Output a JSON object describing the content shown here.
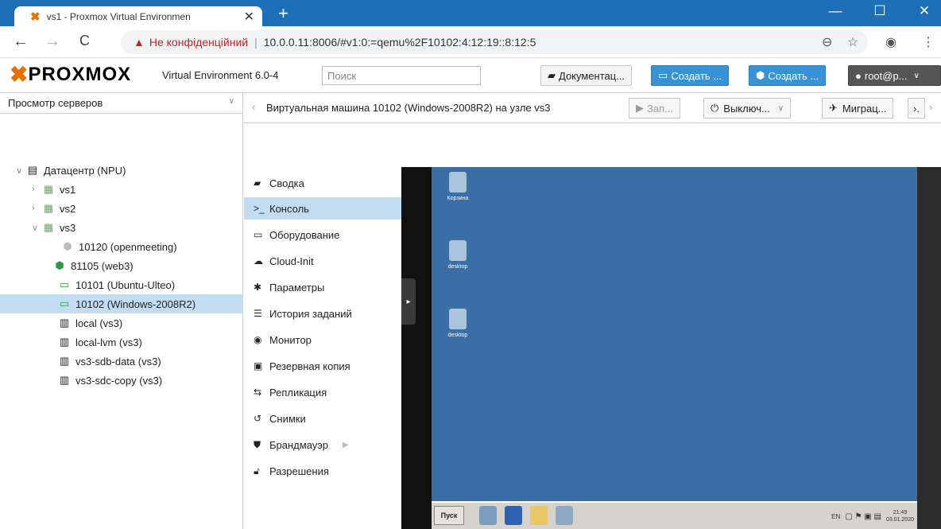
{
  "browser": {
    "tab_title": "vs1 - Proxmox Virtual Environmen",
    "tab_close": "✕",
    "new_tab": "+",
    "win_min": "—",
    "win_max": "☐",
    "win_close": "✕",
    "nav_back": "←",
    "nav_forward": "→",
    "nav_reload": "C",
    "security_warning": "Не конфіденційний",
    "url": "10.0.0.11:8006/#v1:0:=qemu%2F10102:4:12:19::8:12:5"
  },
  "header": {
    "logo_text": "PROXMOX",
    "version": "Virtual Environment 6.0-4",
    "search_placeholder": "Поиск",
    "docs_label": "Документац...",
    "create_vm_label": "Создать ...",
    "create_ct_label": "Создать ...",
    "user_label": "root@p...",
    "accent_color": "#e57000"
  },
  "tree": {
    "view_selector": "Просмотр серверов",
    "nodes": [
      {
        "label": "Датацентр (NPU)",
        "icon": "datacenter-icon"
      },
      {
        "label": "vs1",
        "icon": "node-icon"
      },
      {
        "label": "vs2",
        "icon": "node-icon"
      },
      {
        "label": "vs3",
        "icon": "node-icon"
      },
      {
        "label": "10120 (openmeeting)",
        "icon": "container-icon"
      },
      {
        "label": "81105 (web3)",
        "icon": "container-running-icon"
      },
      {
        "label": "10101 (Ubuntu-Ulteo)",
        "icon": "vm-running-icon"
      },
      {
        "label": "10102 (Windows-2008R2)",
        "icon": "vm-running-icon"
      },
      {
        "label": "local (vs3)",
        "icon": "storage-icon"
      },
      {
        "label": "local-lvm (vs3)",
        "icon": "storage-icon"
      },
      {
        "label": "vs3-sdb-data (vs3)",
        "icon": "storage-icon"
      },
      {
        "label": "vs3-sdc-copy (vs3)",
        "icon": "storage-icon"
      }
    ]
  },
  "content": {
    "title": "Виртуальная машина 10102 (Windows-2008R2) на узле vs3",
    "start_label": "Зап...",
    "shutdown_label": "Выключ...",
    "migrate_label": "Миграц...",
    "more_label": "›."
  },
  "menu": [
    {
      "label": "Сводка",
      "icon": "book-icon"
    },
    {
      "label": "Консоль",
      "icon": "terminal-icon"
    },
    {
      "label": "Оборудование",
      "icon": "monitor-icon"
    },
    {
      "label": "Cloud-Init",
      "icon": "cloud-icon"
    },
    {
      "label": "Параметры",
      "icon": "gear-icon"
    },
    {
      "label": "История заданий",
      "icon": "list-icon"
    },
    {
      "label": "Монитор",
      "icon": "eye-icon"
    },
    {
      "label": "Резервная копия",
      "icon": "floppy-icon"
    },
    {
      "label": "Репликация",
      "icon": "retweet-icon"
    },
    {
      "label": "Снимки",
      "icon": "history-icon"
    },
    {
      "label": "Брандмауэр",
      "icon": "shield-icon"
    },
    {
      "label": "Разрешения",
      "icon": "unlock-icon"
    }
  ],
  "vm_desktop": {
    "icons": [
      "Корзина",
      "desktop",
      "desktop"
    ],
    "start_label": "Пуск",
    "tray_lang": "EN",
    "clock_time": "21:49",
    "clock_date": "03.01.2020"
  }
}
